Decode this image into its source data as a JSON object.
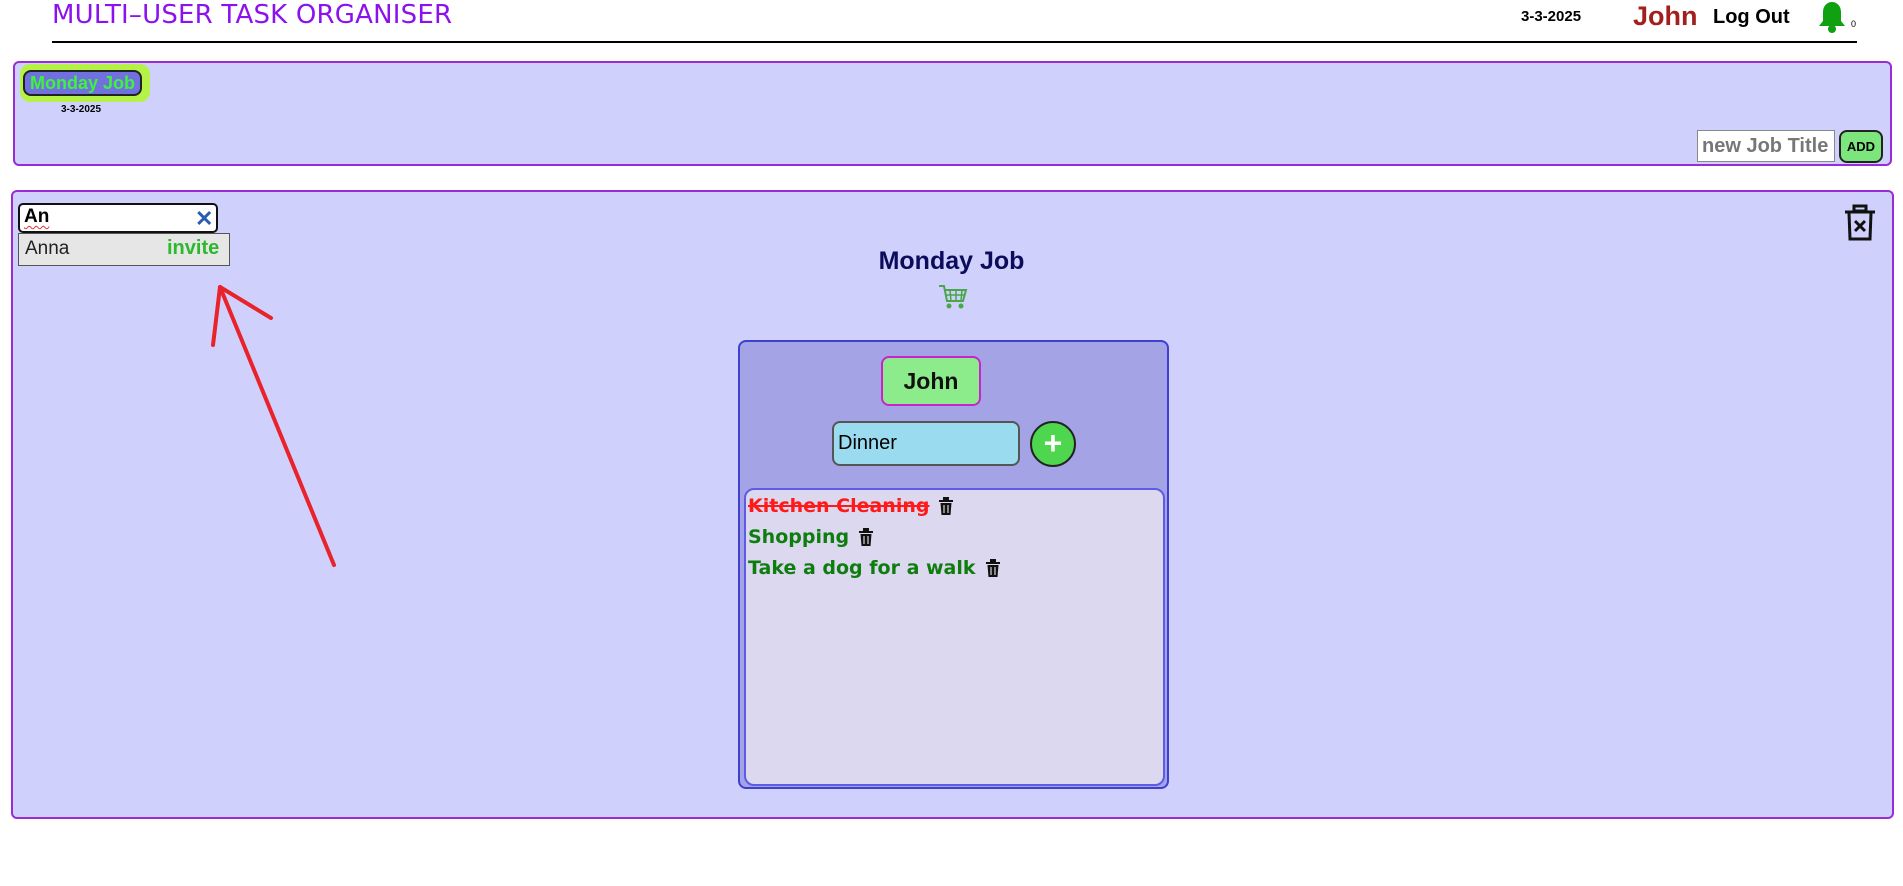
{
  "header": {
    "app_title": "MULTI–USER TASK ORGANISER",
    "date": "3-3-2025",
    "user": "John",
    "logout_label": "Log Out",
    "notification_icon": "bell-icon",
    "notification_count": "0"
  },
  "jobs_bar": {
    "jobs": [
      {
        "title": "Monday Job",
        "date": "3-3-2025"
      }
    ],
    "new_job_placeholder": "new Job Title",
    "add_label": "ADD"
  },
  "invite": {
    "search_value": "An",
    "clear_icon": "close-icon",
    "suggestions": [
      {
        "name": "Anna",
        "action": "invite"
      }
    ]
  },
  "job": {
    "title": "Monday Job",
    "icon": "cart-icon",
    "delete_icon": "trash-x-icon"
  },
  "user_card": {
    "name": "John",
    "task_input_value": "Dinner",
    "add_icon": "plus-icon",
    "tasks": [
      {
        "label": "Kitchen Cleaning",
        "done": true
      },
      {
        "label": "Shopping",
        "done": false
      },
      {
        "label": "Take a dog for a walk",
        "done": false
      }
    ]
  },
  "colors": {
    "panel_bg": "#d0d0fc",
    "panel_border": "#9a2bd6",
    "title_purple": "#8b12ee",
    "user_red": "#a31f1f",
    "done_red": "#ff1a1a",
    "open_green": "#0e7d0e",
    "annotation_red": "#e8232b"
  }
}
